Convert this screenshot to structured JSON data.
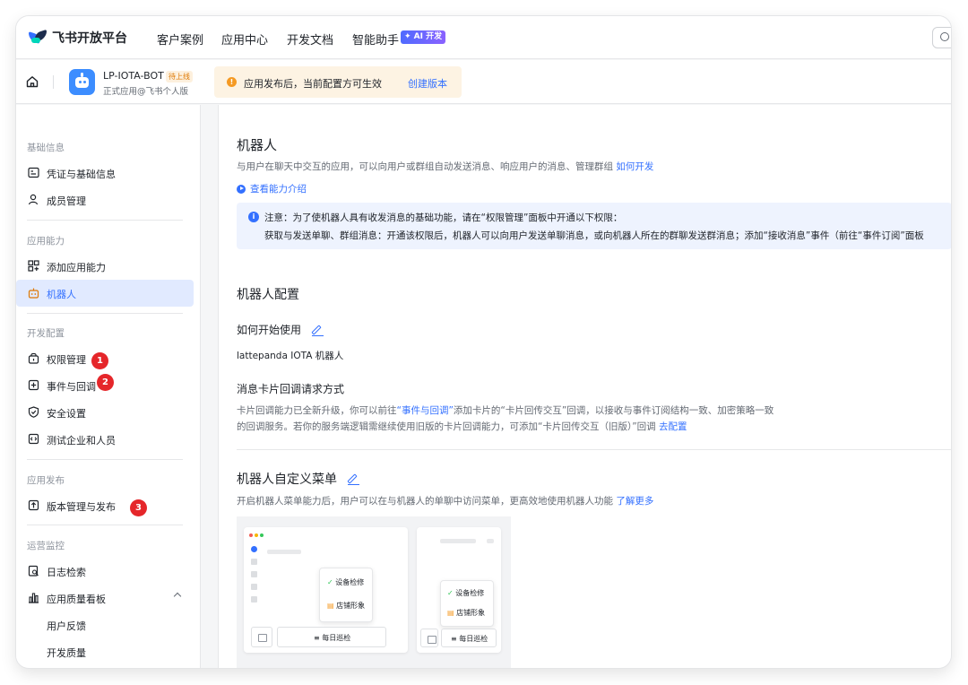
{
  "topnav": {
    "logo_text": "飞书开放平台",
    "items": [
      "客户案例",
      "应用中心",
      "开发文档",
      "智能助手"
    ],
    "ai_badge": "✦ AI 开发"
  },
  "app": {
    "name": "LP-IOTA-BOT",
    "status": "待上线",
    "subtitle": "正式应用@飞书个人版",
    "notice_text": "应用发布后，当前配置方可生效",
    "notice_link": "创建版本"
  },
  "sidebar": {
    "sections": [
      {
        "title": "基础信息",
        "items": [
          "凭证与基础信息",
          "成员管理"
        ]
      },
      {
        "title": "应用能力",
        "items": [
          "添加应用能力",
          "机器人"
        ]
      },
      {
        "title": "开发配置",
        "items": [
          "权限管理",
          "事件与回调",
          "安全设置",
          "测试企业和人员"
        ]
      },
      {
        "title": "应用发布",
        "items": [
          "版本管理与发布"
        ]
      },
      {
        "title": "运营监控",
        "items": [
          "日志检索",
          "应用质量看板",
          "用户反馈",
          "开发质量"
        ]
      }
    ],
    "badges": [
      "1",
      "2",
      "3"
    ]
  },
  "main": {
    "title": "机器人",
    "desc": "与用户在聊天中交互的应用，可以向用户或群组自动发送消息、响应用户的消息、管理群组",
    "desc_link": "如何开发",
    "intro_link": "查看能力介绍",
    "info_line1": "注意：为了使机器人具有收发消息的基础功能，请在“权限管理”面板中开通以下权限：",
    "info_line2": "获取与发送单聊、群组消息：开通该权限后，机器人可以向用户发送单聊消息，或向机器人所在的群聊发送群消息；添加“接收消息”事件（前往“事件订阅”面板",
    "config_title": "机器人配置",
    "how_title": "如何开始使用",
    "how_value": "lattepanda IOTA 机器人",
    "card_title": "消息卡片回调请求方式",
    "card_desc1_a": "卡片回调能力已全新升级，你可以前往",
    "card_desc1_link": "“事件与回调”",
    "card_desc1_b": "添加卡片的“卡片回传交互”回调，以接收与事件订阅结构一致、加密策略一致",
    "card_desc2": "的回调服务。若你的服务端逻辑需继续使用旧版的卡片回调能力，可添加“卡片回传交互（旧版）”回调",
    "card_desc2_link": "去配置",
    "menu_title": "机器人自定义菜单",
    "menu_desc": "开启机器人菜单能力后，用户可以在与机器人的单聊中访问菜单，更高效地使用机器人功能",
    "menu_link": "了解更多",
    "preview": {
      "item1": "设备检修",
      "item2": "店铺形象",
      "item3": "每日巡检"
    }
  }
}
